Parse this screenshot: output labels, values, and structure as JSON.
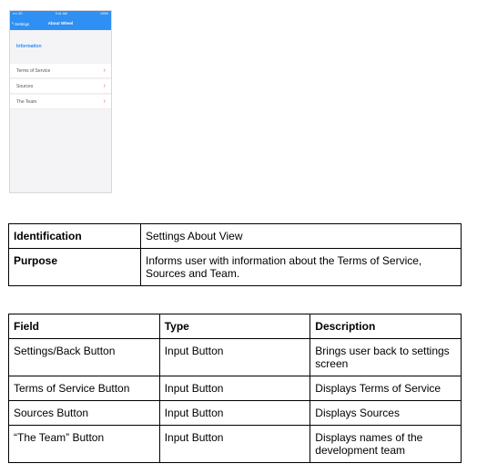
{
  "phone": {
    "status": {
      "carrier": "•••• 3G",
      "time": "9:41 AM",
      "battery": "100%"
    },
    "navbar": {
      "back_label": "Settings",
      "title": "About Wheel"
    },
    "section_header": "Information",
    "rows": [
      {
        "label": "Terms of Service"
      },
      {
        "label": "Sources"
      },
      {
        "label": "The Team"
      }
    ],
    "accent_color": "#2f8ff2",
    "chevron_color": "#ea5a6f"
  },
  "identification_table": {
    "rows": [
      {
        "label": "Identification",
        "value": "Settings About View"
      },
      {
        "label": "Purpose",
        "value": "Informs user with information about the Terms of Service, Sources and Team."
      }
    ]
  },
  "field_table": {
    "headers": [
      "Field",
      "Type",
      "Description"
    ],
    "rows": [
      {
        "field": "Settings/Back Button",
        "type": "Input Button",
        "description": "Brings user back to settings screen"
      },
      {
        "field": "Terms of Service Button",
        "type": "Input Button",
        "description": "Displays Terms of Service"
      },
      {
        "field": "Sources Button",
        "type": "Input Button",
        "description": "Displays Sources"
      },
      {
        "field": "“The Team” Button",
        "type": "Input Button",
        "description": "Displays names of the development team"
      }
    ]
  }
}
